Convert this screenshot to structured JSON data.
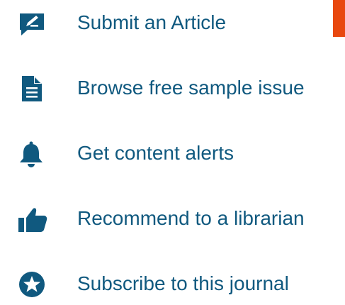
{
  "menu": {
    "items": [
      {
        "label": "Submit an Article",
        "icon": "edit-icon"
      },
      {
        "label": "Browse free sample issue",
        "icon": "document-icon"
      },
      {
        "label": "Get content alerts",
        "icon": "bell-icon"
      },
      {
        "label": "Recommend to a librarian",
        "icon": "thumbs-up-icon"
      },
      {
        "label": "Subscribe to this journal",
        "icon": "star-circle-icon"
      }
    ]
  },
  "colors": {
    "link": "#10597f",
    "accent": "#e8480f"
  }
}
